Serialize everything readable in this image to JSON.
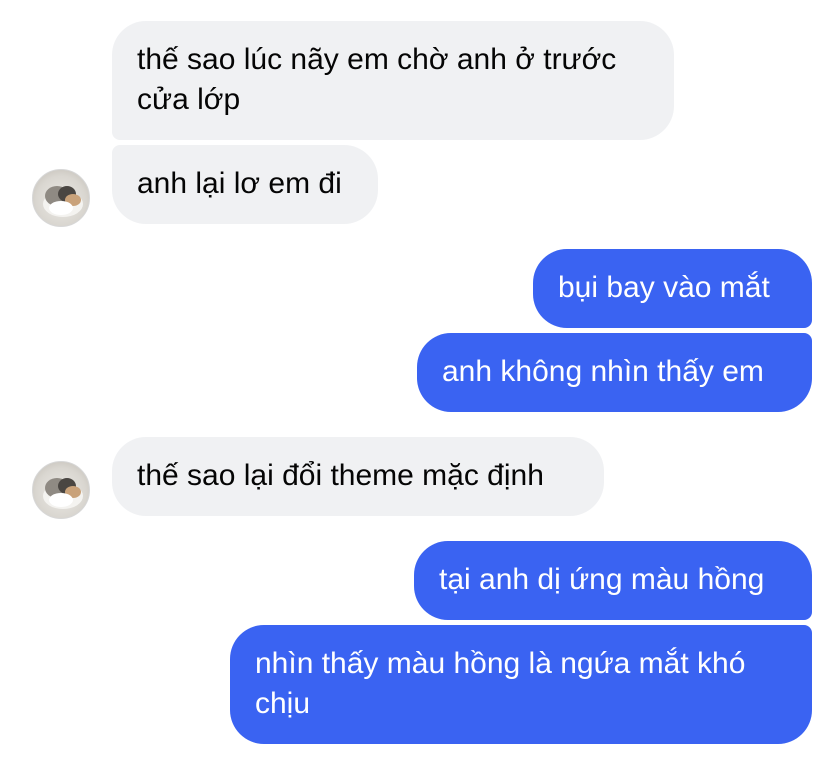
{
  "conversation": {
    "messages": [
      {
        "sender": "other",
        "text": "thế sao lúc nãy em chờ anh ở trước cửa lớp"
      },
      {
        "sender": "other",
        "text": "anh lại lơ em đi"
      },
      {
        "sender": "me",
        "text": "bụi bay vào mắt"
      },
      {
        "sender": "me",
        "text": "anh không nhìn thấy em"
      },
      {
        "sender": "other",
        "text": "thế sao lại đổi theme mặc định"
      },
      {
        "sender": "me",
        "text": "tại anh dị ứng màu hồng"
      },
      {
        "sender": "me",
        "text": "nhìn thấy màu hồng là ngứa mắt khó chịu"
      }
    ]
  },
  "avatar": {
    "icon": "cat-avatar-icon"
  },
  "colors": {
    "incoming_bubble": "#f0f1f3",
    "outgoing_bubble": "#3a63f2",
    "incoming_text": "#050505",
    "outgoing_text": "#ffffff"
  }
}
